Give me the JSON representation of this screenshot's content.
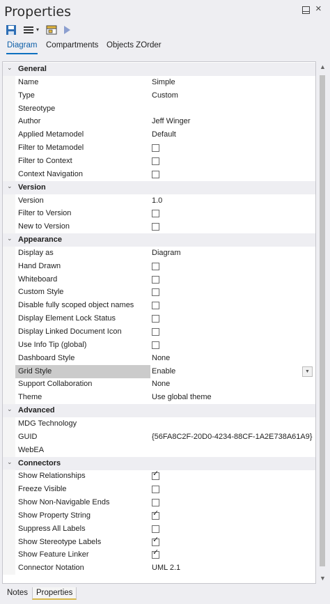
{
  "window": {
    "title": "Properties"
  },
  "toolbar": {
    "save_icon": "save-icon",
    "menu_icon": "menu-icon",
    "dropdown_glyph": "▾",
    "package_icon": "package-icon",
    "play_icon": "play-icon"
  },
  "tabs": [
    "Diagram",
    "Compartments",
    "Objects ZOrder"
  ],
  "bottom_tabs": [
    "Notes",
    "Properties"
  ],
  "scroll": {
    "up": "▲",
    "down": "▼"
  },
  "colors": {
    "accent": "#0e70c0",
    "selected_row": "#cbcbcb",
    "category_bg": "#eeeef2",
    "bottom_tab_indicator": "#d8b94a"
  },
  "rows": [
    {
      "kind": "category",
      "label": "General"
    },
    {
      "kind": "prop",
      "name": "Name",
      "value": "Simple"
    },
    {
      "kind": "prop",
      "name": "Type",
      "value": "Custom"
    },
    {
      "kind": "prop",
      "name": "Stereotype",
      "value": ""
    },
    {
      "kind": "prop",
      "name": "Author",
      "value": "Jeff Winger"
    },
    {
      "kind": "prop",
      "name": "Applied Metamodel",
      "value": "Default"
    },
    {
      "kind": "check",
      "name": "Filter to Metamodel",
      "checked": false
    },
    {
      "kind": "check",
      "name": "Filter to Context",
      "checked": false
    },
    {
      "kind": "check",
      "name": "Context Navigation",
      "checked": false
    },
    {
      "kind": "category",
      "label": "Version"
    },
    {
      "kind": "prop",
      "name": "Version",
      "value": "1.0"
    },
    {
      "kind": "check",
      "name": "Filter to Version",
      "checked": false
    },
    {
      "kind": "check",
      "name": "New to Version",
      "checked": false
    },
    {
      "kind": "category",
      "label": "Appearance"
    },
    {
      "kind": "prop",
      "name": "Display as",
      "value": "Diagram"
    },
    {
      "kind": "check",
      "name": "Hand Drawn",
      "checked": false
    },
    {
      "kind": "check",
      "name": "Whiteboard",
      "checked": false
    },
    {
      "kind": "check",
      "name": "Custom Style",
      "checked": false
    },
    {
      "kind": "check",
      "name": "Disable fully scoped object names",
      "checked": false
    },
    {
      "kind": "check",
      "name": "Display Element Lock Status",
      "checked": false
    },
    {
      "kind": "check",
      "name": "Display Linked Document Icon",
      "checked": false
    },
    {
      "kind": "check",
      "name": "Use Info Tip (global)",
      "checked": false
    },
    {
      "kind": "prop",
      "name": "Dashboard Style",
      "value": "None"
    },
    {
      "kind": "prop",
      "name": "Grid Style",
      "value": "Enable",
      "selected": true,
      "dropdown": true
    },
    {
      "kind": "prop",
      "name": "Support Collaboration",
      "value": "None"
    },
    {
      "kind": "prop",
      "name": "Theme",
      "value": "Use global theme"
    },
    {
      "kind": "category",
      "label": "Advanced"
    },
    {
      "kind": "prop",
      "name": "MDG Technology",
      "value": ""
    },
    {
      "kind": "prop",
      "name": "GUID",
      "value": "{56FA8C2F-20D0-4234-88CF-1A2E738A61A9}"
    },
    {
      "kind": "prop",
      "name": "WebEA",
      "value": ""
    },
    {
      "kind": "category",
      "label": "Connectors"
    },
    {
      "kind": "check",
      "name": "Show Relationships",
      "checked": true
    },
    {
      "kind": "check",
      "name": "Freeze Visible",
      "checked": false
    },
    {
      "kind": "check",
      "name": "Show Non-Navigable Ends",
      "checked": false
    },
    {
      "kind": "check",
      "name": "Show Property String",
      "checked": true
    },
    {
      "kind": "check",
      "name": "Suppress All Labels",
      "checked": false
    },
    {
      "kind": "check",
      "name": "Show Stereotype Labels",
      "checked": true
    },
    {
      "kind": "check",
      "name": "Show Feature Linker",
      "checked": true
    },
    {
      "kind": "prop",
      "name": "Connector Notation",
      "value": "UML 2.1"
    }
  ]
}
